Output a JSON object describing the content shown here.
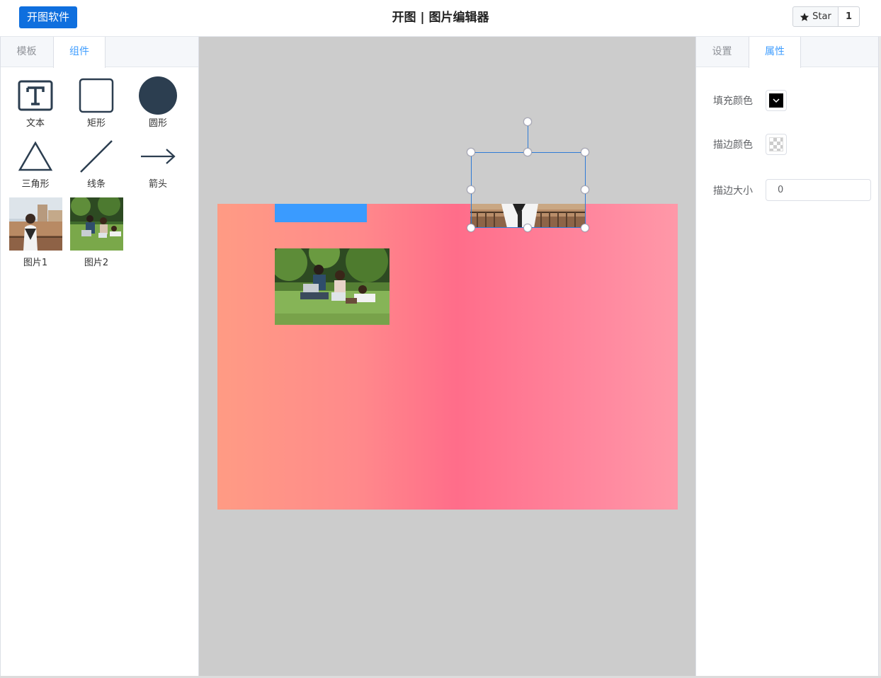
{
  "header": {
    "brand_label": "开图软件",
    "title": "开图 | 图片编辑器",
    "star_label": "Star",
    "star_count": "1"
  },
  "left_panel": {
    "tabs": [
      {
        "label": "模板",
        "active": false
      },
      {
        "label": "组件",
        "active": true
      }
    ],
    "components": [
      {
        "label": "文本",
        "icon": "text-icon"
      },
      {
        "label": "矩形",
        "icon": "rectangle-icon"
      },
      {
        "label": "圆形",
        "icon": "circle-icon"
      },
      {
        "label": "三角形",
        "icon": "triangle-icon"
      },
      {
        "label": "线条",
        "icon": "line-icon"
      },
      {
        "label": "箭头",
        "icon": "arrow-icon"
      },
      {
        "label": "图片1",
        "icon": "image-thumbnail"
      },
      {
        "label": "图片2",
        "icon": "image-thumbnail"
      }
    ]
  },
  "right_panel": {
    "tabs": [
      {
        "label": "设置",
        "active": false
      },
      {
        "label": "属性",
        "active": true
      }
    ],
    "fill_color_label": "填充颜色",
    "fill_color": "#000000",
    "stroke_color_label": "描边颜色",
    "stroke_size_label": "描边大小",
    "stroke_size_value": "0"
  },
  "colors": {
    "brand": "#0f6fde",
    "accent": "#409eff",
    "canvas_bg": "#cccccc",
    "shape_dark": "#2c3e50",
    "selection": "#2f7bd6"
  }
}
